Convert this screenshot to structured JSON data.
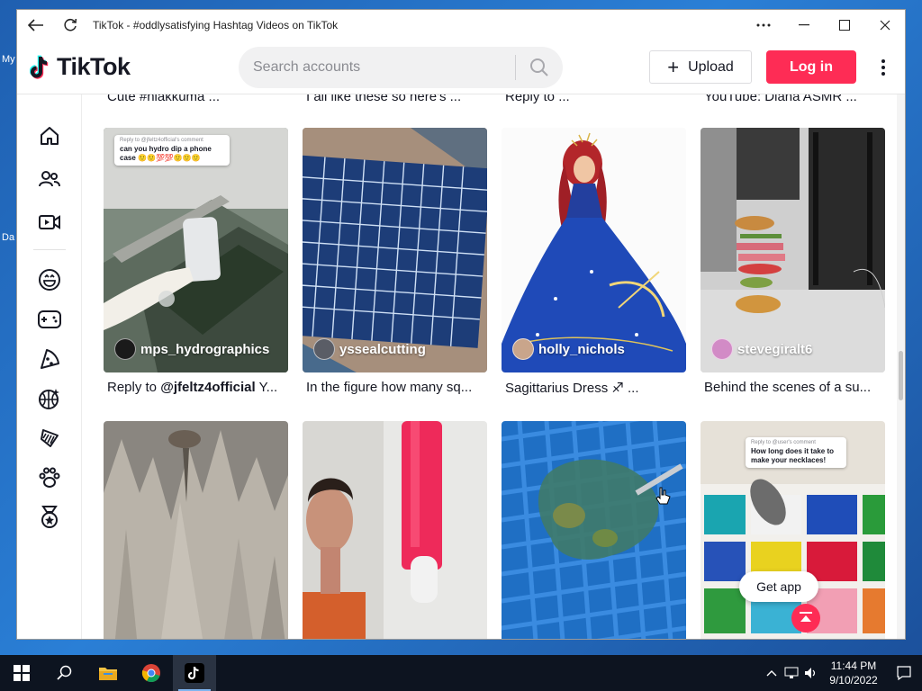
{
  "desktop": {
    "label_top": "My",
    "label_bottom": "Da"
  },
  "window": {
    "title": "TikTok - #oddlysatisfying Hashtag Videos on TikTok"
  },
  "header": {
    "logo_text": "TikTok",
    "search_placeholder": "Search accounts",
    "upload_label": "Upload",
    "login_label": "Log in"
  },
  "sidebar": {
    "icons": [
      "home-icon",
      "following-icon",
      "live-icon",
      "comedy-icon",
      "gaming-icon",
      "food-icon",
      "sports-icon",
      "beauty-icon",
      "animals-icon",
      "achievement-icon"
    ]
  },
  "previous_row_captions": [
    "Cute #hiakkuma ...",
    "I all like these so here's ...",
    "Reply to ...",
    "YouTube: Diana ASMR ..."
  ],
  "videos_row1": [
    {
      "username": "mps_hydrographics",
      "caption_prefix": "Reply to ",
      "caption_bold": "@jfeltz4official",
      "caption_rest": " Y...",
      "comment_head": "Reply to @jfeltz4official's comment",
      "comment_body": "can you hydro dip a phone case 🙂🙂💯💯🙂🙂🙂"
    },
    {
      "username": "yssealcutting",
      "caption": "In the figure how many sq..."
    },
    {
      "username": "holly_nichols",
      "caption": "Sagittarius Dress ♐ ..."
    },
    {
      "username": "stevegiralt6",
      "caption": "Behind the scenes of a su..."
    }
  ],
  "videos_row2": [
    {
      "username": ""
    },
    {
      "username": ""
    },
    {
      "username": ""
    },
    {
      "username": "",
      "comment_head": "Reply to @user's comment",
      "comment_body": "How long does it take to make your necklaces!"
    }
  ],
  "get_app_label": "Get app",
  "taskbar": {
    "time": "11:44 PM",
    "date": "9/10/2022"
  },
  "colors": {
    "brand_red": "#fe2c55",
    "brand_cyan": "#25f4ee",
    "text_primary": "#161823"
  }
}
